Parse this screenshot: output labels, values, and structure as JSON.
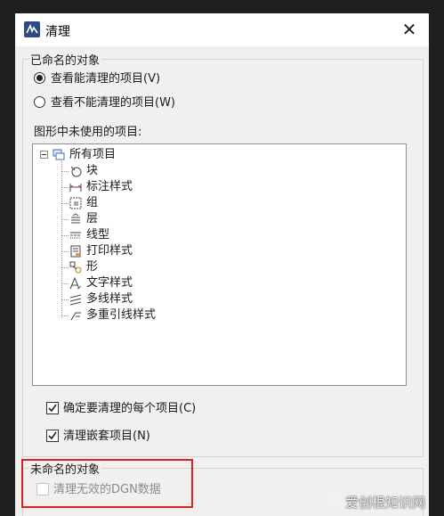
{
  "window": {
    "title": "清理",
    "close_glyph": "✕"
  },
  "named_group": {
    "title": "已命名的对象",
    "radio_view_purgeable": {
      "label": "查看能清理的项目(V)",
      "checked": true
    },
    "radio_view_nonpurgeable": {
      "label": "查看不能清理的项目(W)",
      "checked": false
    },
    "tree_caption": "图形中未使用的项目:",
    "tree": {
      "root": {
        "label": "所有项目",
        "icon": "folder-tree-icon"
      },
      "items": [
        {
          "label": "块",
          "icon": "block-icon"
        },
        {
          "label": "标注样式",
          "icon": "dimension-style-icon"
        },
        {
          "label": "组",
          "icon": "group-icon"
        },
        {
          "label": "层",
          "icon": "layer-icon"
        },
        {
          "label": "线型",
          "icon": "linetype-icon"
        },
        {
          "label": "打印样式",
          "icon": "plot-style-icon"
        },
        {
          "label": "形",
          "icon": "shape-icon"
        },
        {
          "label": "文字样式",
          "icon": "text-style-icon"
        },
        {
          "label": "多线样式",
          "icon": "multiline-style-icon"
        },
        {
          "label": "多重引线样式",
          "icon": "multileader-style-icon"
        }
      ]
    },
    "check_confirm_each": {
      "label": "确定要清理的每个项目(C)",
      "checked": true
    },
    "check_purge_nested": {
      "label": "清理嵌套项目(N)",
      "checked": true
    }
  },
  "unnamed_group": {
    "title": "未命名的对象",
    "check_invalid_dgn": {
      "label": "清理无效的DGN数据",
      "checked": false,
      "enabled": false
    }
  },
  "watermark": {
    "text": "爱创根知识网"
  },
  "colors": {
    "highlight": "#e02020",
    "app_icon": "#2d4a85"
  }
}
